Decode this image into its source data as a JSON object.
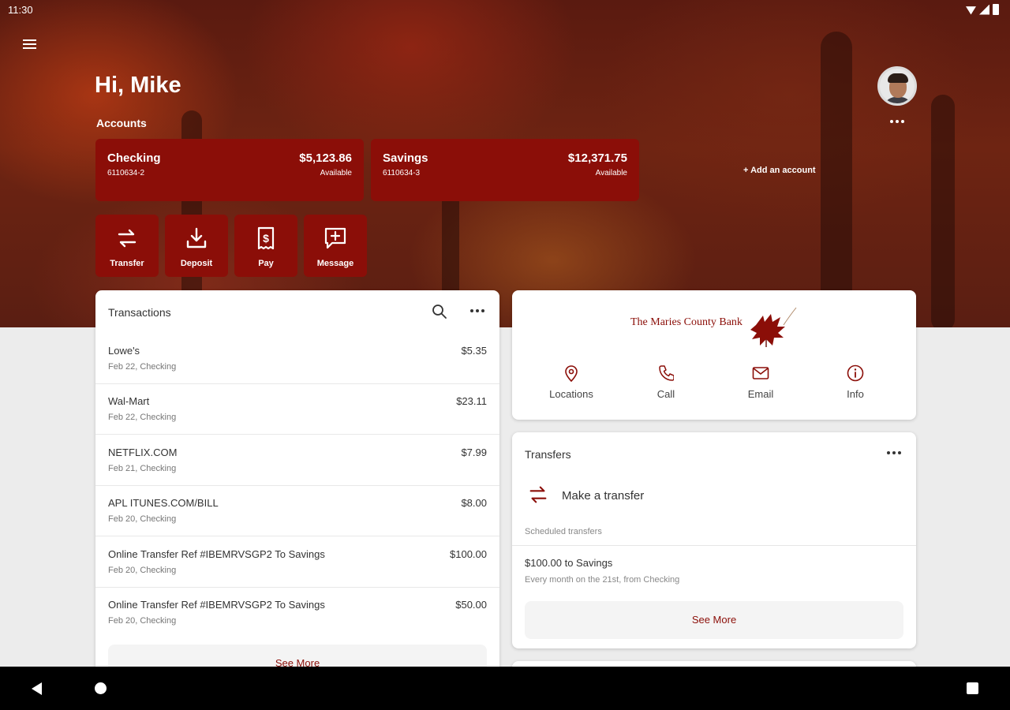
{
  "status_bar": {
    "time": "11:30"
  },
  "header": {
    "greeting": "Hi, Mike",
    "accounts_label": "Accounts",
    "add_account": "+ Add an account"
  },
  "accounts": [
    {
      "name": "Checking",
      "number": "6110634-2",
      "balance": "$5,123.86",
      "balance_label": "Available"
    },
    {
      "name": "Savings",
      "number": "6110634-3",
      "balance": "$12,371.75",
      "balance_label": "Available"
    }
  ],
  "quick_actions": [
    {
      "label": "Transfer",
      "icon": "transfer-icon"
    },
    {
      "label": "Deposit",
      "icon": "deposit-icon"
    },
    {
      "label": "Pay",
      "icon": "pay-bill-icon"
    },
    {
      "label": "Message",
      "icon": "message-icon"
    }
  ],
  "transactions": {
    "title": "Transactions",
    "items": [
      {
        "description": "Lowe's",
        "meta": "Feb 22, Checking",
        "amount": "$5.35"
      },
      {
        "description": "Wal-Mart",
        "meta": "Feb 22, Checking",
        "amount": "$23.11"
      },
      {
        "description": "NETFLIX.COM",
        "meta": "Feb 21, Checking",
        "amount": "$7.99"
      },
      {
        "description": "APL ITUNES.COM/BILL",
        "meta": "Feb 20, Checking",
        "amount": "$8.00"
      },
      {
        "description": "Online Transfer Ref #IBEMRVSGP2 To Savings",
        "meta": "Feb 20, Checking",
        "amount": "$100.00"
      },
      {
        "description": "Online Transfer Ref #IBEMRVSGP2 To Savings",
        "meta": "Feb 20, Checking",
        "amount": "$50.00"
      }
    ],
    "see_more": "See More"
  },
  "bank": {
    "name": "The Maries County Bank",
    "contacts": [
      {
        "label": "Locations",
        "icon": "location-pin-icon"
      },
      {
        "label": "Call",
        "icon": "phone-icon"
      },
      {
        "label": "Email",
        "icon": "email-icon"
      },
      {
        "label": "Info",
        "icon": "info-icon"
      }
    ]
  },
  "transfers": {
    "title": "Transfers",
    "make_transfer": "Make a transfer",
    "scheduled_label": "Scheduled transfers",
    "scheduled": [
      {
        "title": "$100.00 to Savings",
        "detail": "Every month on the 21st, from Checking"
      }
    ],
    "see_more": "See More"
  },
  "colors": {
    "brand": "#8b0e08",
    "background": "#ececec",
    "card": "#ffffff"
  }
}
